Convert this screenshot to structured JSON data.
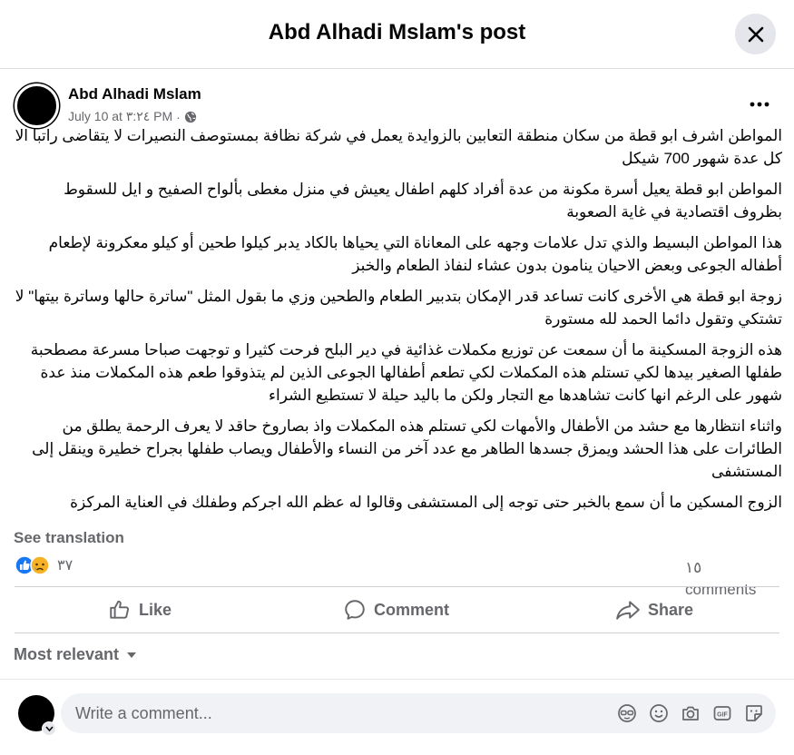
{
  "header": {
    "title": "Abd Alhadi Mslam's post"
  },
  "post": {
    "author": "Abd Alhadi Mslam",
    "date": "July 10 at ٣:٢٤ PM",
    "separator": "·",
    "paragraphs": [
      "المواطن اشرف ابو قطة من سكان منطقة التعابين بالزوايدة يعمل في شركة نظافة بمستوصف النصيرات لا يتقاضى راتبا الا كل عدة شهور 700 شيكل",
      "المواطن ابو قطة يعيل أسرة مكونة من عدة أفراد كلهم اطفال يعيش في منزل مغطى بألواح الصفيح و ايل للسقوط بظروف اقتصادية في غاية الصعوبة",
      "هذا المواطن البسيط والذي تدل علامات وجهه على المعاناة التي يحياها بالكاد يدبر كيلوا طحين أو كيلو معكرونة لإطعام أطفاله الجوعى وبعض الاحيان ينامون بدون عشاء لنفاذ الطعام والخبز",
      "زوجة ابو قطة هي الأخرى كانت  تساعد  قدر الإمكان بتدبير الطعام والطحين وزي ما بقول المثل \"ساترة حالها وساترة  بيتها\" لا تشتكي وتقول دائما الحمد لله مستورة",
      "هذه الزوجة المسكينة ما أن سمعت  عن توزيع مكملات غذائية في دير البلح  فرحت كثيرا  و توجهت صباحا مسرعة مصطحبة طفلها الصغير بيدها لكي تستلم هذه المكملات لكي تطعم أطفالها الجوعى الذين لم يتذوقوا طعم هذه المكملات منذ عدة شهور على الرغم انها كانت تشاهدها مع التجار ولكن ما باليد حيلة لا تستطيع الشراء",
      "واثناء انتظارها مع حشد من الأطفال والأمهات لكي تستلم هذه المكملات  واذ بصاروخ حاقد لا يعرف الرحمة  يطلق من الطائرات على هذا الحشد ويمزق جسدها الطاهر مع عدد آخر من النساء والأطفال  ويصاب طفلها بجراح خطيرة وينقل إلى المستشفى",
      "الزوج المسكين ما أن سمع بالخبر حتى توجه إلى المستشفى وقالوا له عظم الله اجركم وطفلك في العناية المركزة"
    ],
    "see_translation": "See translation",
    "reaction_count": "٣٧",
    "comment_count": "١٥ comments"
  },
  "actions": {
    "like": "Like",
    "comment": "Comment",
    "share": "Share"
  },
  "filter": {
    "label": "Most relevant"
  },
  "composer": {
    "placeholder": "Write a comment..."
  },
  "colors": {
    "like_blue": "#1877f2",
    "secondary_text": "#65676b",
    "sad_yellow": "#f7b125"
  }
}
